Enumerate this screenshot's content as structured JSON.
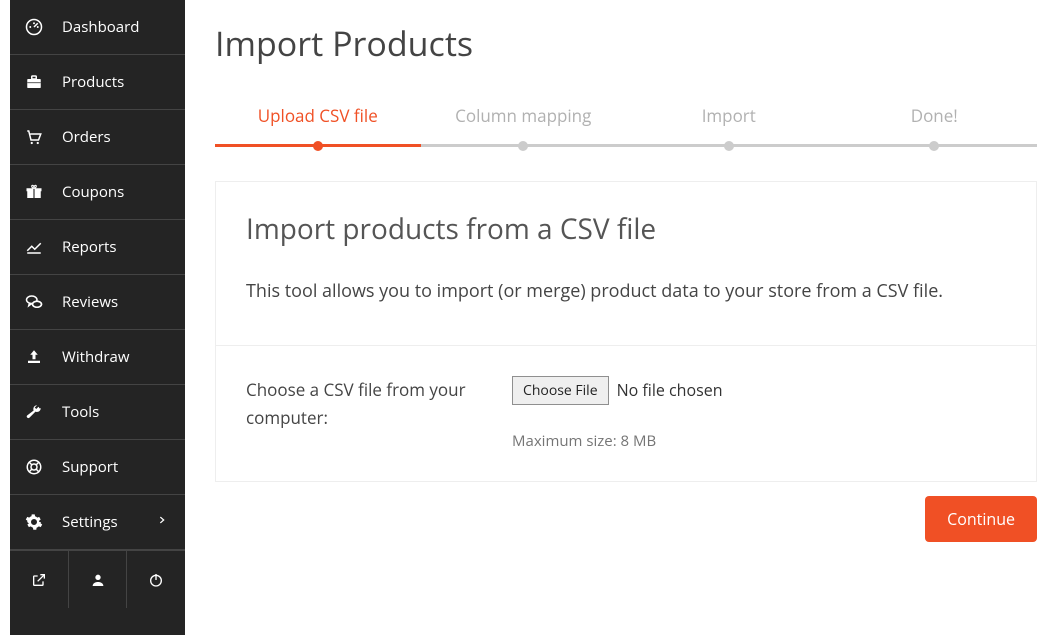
{
  "sidebar": {
    "items": [
      {
        "label": "Dashboard"
      },
      {
        "label": "Products"
      },
      {
        "label": "Orders"
      },
      {
        "label": "Coupons"
      },
      {
        "label": "Reports"
      },
      {
        "label": "Reviews"
      },
      {
        "label": "Withdraw"
      },
      {
        "label": "Tools"
      },
      {
        "label": "Support"
      },
      {
        "label": "Settings"
      }
    ]
  },
  "page": {
    "title": "Import Products"
  },
  "stepper": {
    "steps": [
      {
        "label": "Upload CSV file"
      },
      {
        "label": "Column mapping"
      },
      {
        "label": "Import"
      },
      {
        "label": "Done!"
      }
    ]
  },
  "card": {
    "title": "Import products from a CSV file",
    "desc": "This tool allows you to import (or merge) product data to your store from a CSV file."
  },
  "form": {
    "choose_label": "Choose a CSV file from your computer:",
    "choose_button": "Choose File",
    "file_status": "No file chosen",
    "max_size": "Maximum size: 8 MB",
    "continue": "Continue"
  }
}
